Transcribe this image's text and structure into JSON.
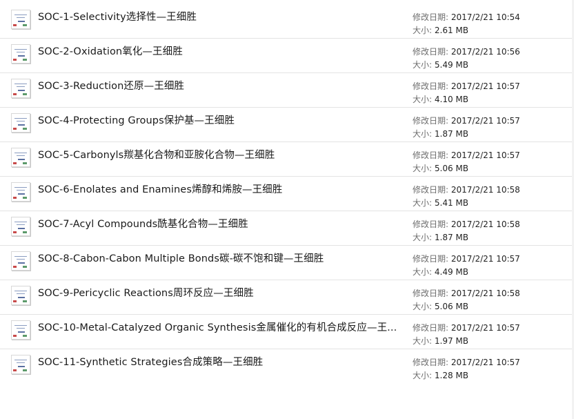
{
  "labels": {
    "modified": "修改日期:",
    "size": "大小:"
  },
  "files": [
    {
      "name": "SOC-1-Selectivity选择性—王细胜",
      "modified": "2017/2/21 10:54",
      "size": "2.61 MB"
    },
    {
      "name": "SOC-2-Oxidation氧化—王细胜",
      "modified": "2017/2/21 10:56",
      "size": "5.49 MB"
    },
    {
      "name": "SOC-3-Reduction还原—王细胜",
      "modified": "2017/2/21 10:57",
      "size": "4.10 MB"
    },
    {
      "name": "SOC-4-Protecting Groups保护基—王细胜",
      "modified": "2017/2/21 10:57",
      "size": "1.87 MB"
    },
    {
      "name": "SOC-5-Carbonyls羰基化合物和亚胺化合物—王细胜",
      "modified": "2017/2/21 10:57",
      "size": "5.06 MB"
    },
    {
      "name": "SOC-6-Enolates and Enamines烯醇和烯胺—王细胜",
      "modified": "2017/2/21 10:58",
      "size": "5.41 MB"
    },
    {
      "name": "SOC-7-Acyl Compounds酰基化合物—王细胜",
      "modified": "2017/2/21 10:58",
      "size": "1.87 MB"
    },
    {
      "name": "SOC-8-Cabon-Cabon Multiple Bonds碳-碳不饱和键—王细胜",
      "modified": "2017/2/21 10:57",
      "size": "4.49 MB"
    },
    {
      "name": "SOC-9-Pericyclic Reactions周环反应—王细胜",
      "modified": "2017/2/21 10:58",
      "size": "5.06 MB"
    },
    {
      "name": "SOC-10-Metal-Catalyzed Organic Synthesis金属催化的有机合成反应—王...",
      "modified": "2017/2/21 10:57",
      "size": "1.97 MB"
    },
    {
      "name": "SOC-11-Synthetic Strategies合成策略—王细胜",
      "modified": "2017/2/21 10:57",
      "size": "1.28 MB"
    }
  ]
}
